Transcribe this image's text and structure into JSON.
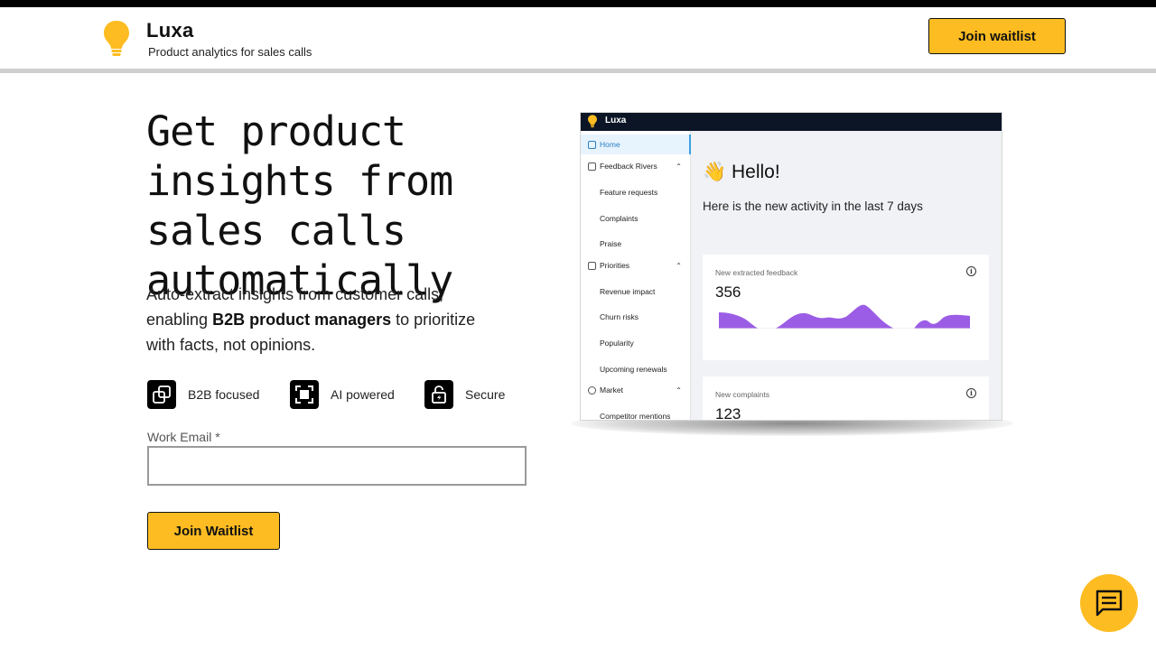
{
  "header": {
    "brand_name": "Luxa",
    "tagline": "Product analytics for sales calls",
    "cta_label": "Join waitlist"
  },
  "hero": {
    "title": "Get product insights from sales calls automatically",
    "description_pre": "Auto-extract insights from customer calls, enabling ",
    "description_bold": "B2B product managers",
    "description_post": " to prioritize with facts, not opinions."
  },
  "features": [
    {
      "label": "B2B focused",
      "icon": "overlapping-squares-icon"
    },
    {
      "label": "AI powered",
      "icon": "focus-square-icon"
    },
    {
      "label": "Secure",
      "icon": "lock-icon"
    }
  ],
  "form": {
    "email_label": "Work Email *",
    "email_value": "",
    "email_placeholder": "",
    "submit_label": "Join Waitlist"
  },
  "product_shot": {
    "brand_name": "Luxa",
    "sidebar": [
      {
        "label": "Home",
        "active": true,
        "icon": "edit-icon",
        "expandable": false
      },
      {
        "label": "Feedback Rivers",
        "icon": "grid-icon",
        "expandable": true
      },
      {
        "label": "Feature requests",
        "sub": true
      },
      {
        "label": "Complaints",
        "sub": true
      },
      {
        "label": "Praise",
        "sub": true
      },
      {
        "label": "Priorities",
        "icon": "list-icon",
        "expandable": true
      },
      {
        "label": "Revenue impact",
        "sub": true
      },
      {
        "label": "Churn risks",
        "sub": true
      },
      {
        "label": "Popularity",
        "sub": true
      },
      {
        "label": "Upcoming renewals",
        "sub": true
      },
      {
        "label": "Market",
        "icon": "check-circle-icon",
        "expandable": true
      },
      {
        "label": "Competitor mentions",
        "sub": true
      }
    ],
    "greeting_emoji": "👋",
    "greeting": "Hello!",
    "subtitle": "Here is the new activity in the last 7 days",
    "cards": [
      {
        "label": "New extracted feedback",
        "value": "356"
      },
      {
        "label": "New complaints",
        "value": "123"
      }
    ]
  },
  "colors": {
    "accent_yellow": "#FDBC21",
    "chart_purple": "#9B5DE5",
    "dark_navy": "#0b1526"
  },
  "chat": {
    "icon": "chat-message-icon"
  }
}
